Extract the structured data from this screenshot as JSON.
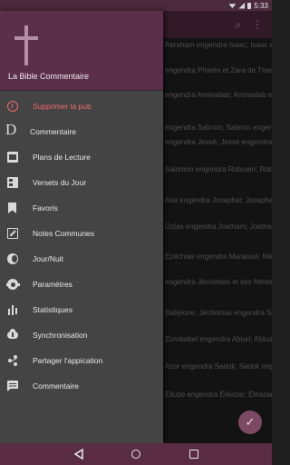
{
  "status_bar": {
    "time": "5:33"
  },
  "background": {
    "verses": [
      "Abraham engendra Isaac; Isaac engendra Jacob; Jacob engendra Juda",
      "engendra Pharès et Zara de Thamar; Phares engendra Esrom;",
      "engendra Aminadab; Aminadab engendra Naasson; Naasson",
      "engendra Salmon; Salmon engendra Booz de Rahab; Booz engendra Obed de Ruth;",
      "engendra Jessé; Jessé engendra David. Le roi David engendra",
      "Salomon engendra Roboam; Roboam engendra Abia; Abia engendra",
      "Asa engendra Josaphat; Josaphat engendra Joram; Joram engendra",
      "Ozias engendra Joatham; Joatham engendra Achaz; Achaz engendra",
      "Ézéchias engendra Manassé; Manassé engendra Amon; Amon",
      "engendra Jéchonias et ses frères, au temps de la déportation à",
      "Babylone, Jéchonias engendra Salathiel;",
      "Zorobabel engendra Abiud; Abiud engendra Éliakim; Éliakim",
      "Azor engendra Sadok; Sadok engendra Achim; Achim engendra",
      "Éliude engendra Éléazar; Éléazar engendra Matthan; Matthan"
    ]
  },
  "drawer": {
    "app_title": "La Bible Commentaire",
    "items": [
      {
        "label": "Supprimer la pub",
        "icon": "info-icon"
      },
      {
        "label": "Commentaire",
        "icon": "d-letter-icon"
      },
      {
        "label": "Plans de Lecture",
        "icon": "calendar-icon"
      },
      {
        "label": "Versets du Jour",
        "icon": "news-icon"
      },
      {
        "label": "Favoris",
        "icon": "bookmark-icon"
      },
      {
        "label": "Notes Communes",
        "icon": "edit-icon"
      },
      {
        "label": "Jour/Nuit",
        "icon": "day-night-icon"
      },
      {
        "label": "Paramètres",
        "icon": "gear-icon"
      },
      {
        "label": "Statistiques",
        "icon": "bar-chart-icon"
      },
      {
        "label": "Synchronisation",
        "icon": "cloud-upload-icon"
      },
      {
        "label": "Partager l'appication",
        "icon": "share-icon"
      },
      {
        "label": "Commentaire",
        "icon": "comment-icon"
      }
    ]
  },
  "colors": {
    "accent": "#5c2f49",
    "highlight": "#f06a6a",
    "drawer_bg": "#444444"
  }
}
